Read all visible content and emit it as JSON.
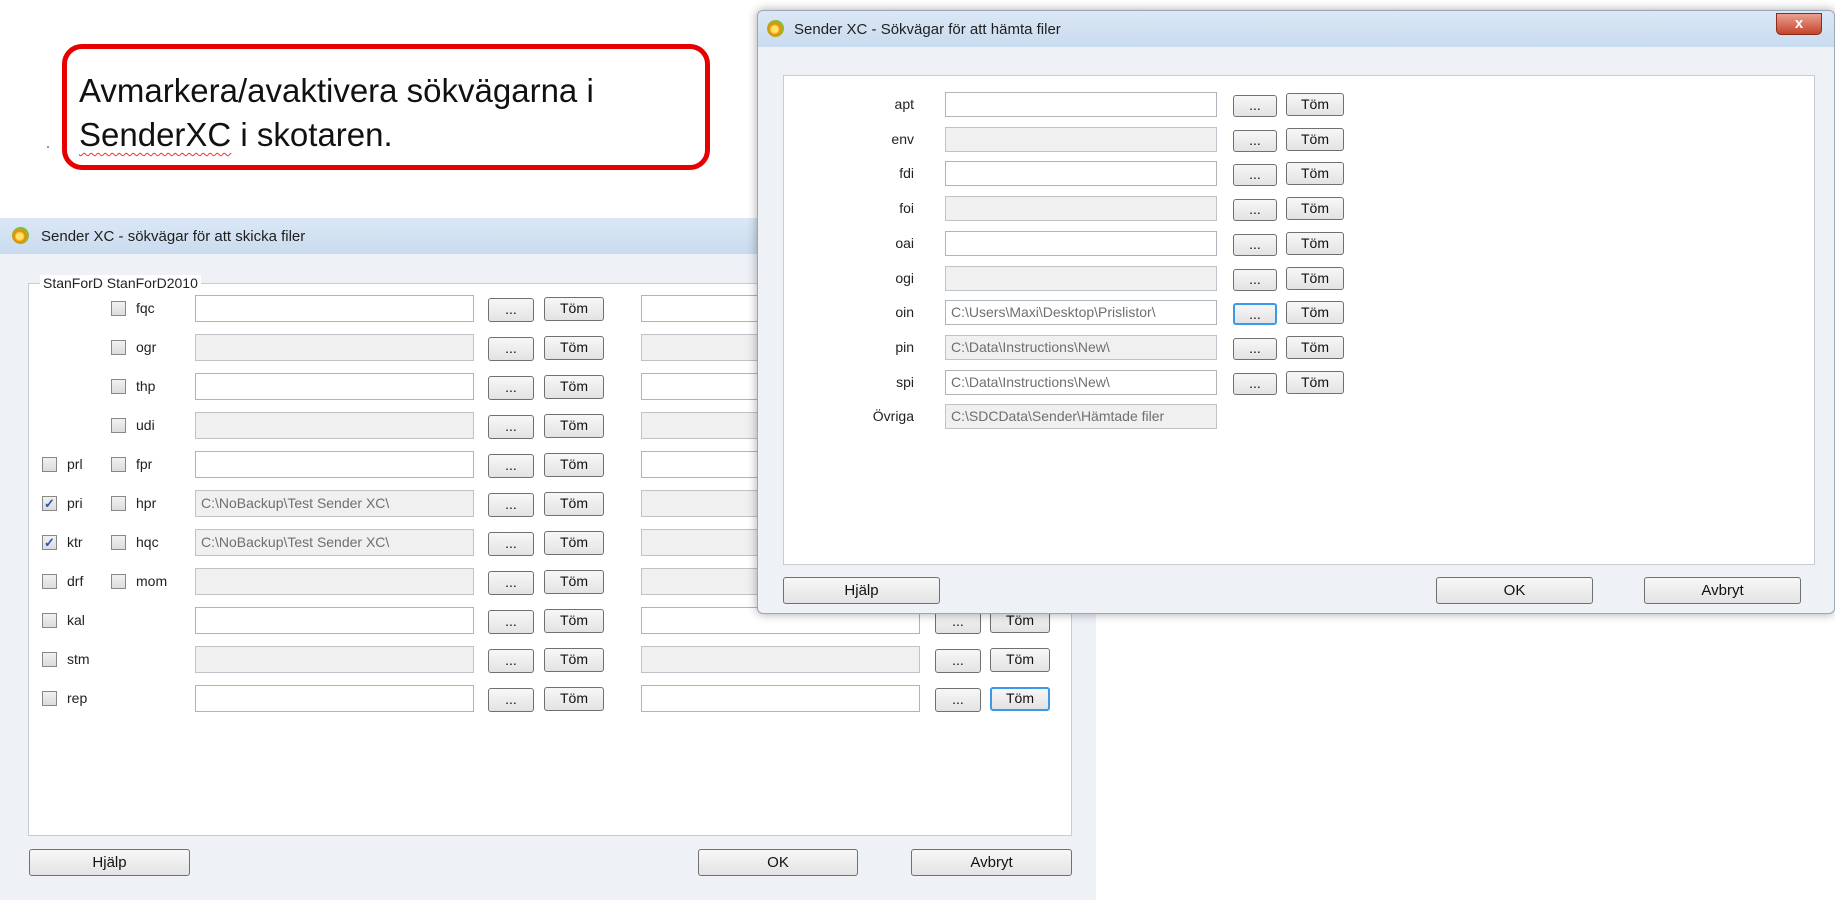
{
  "callout": {
    "line1": "Avmarkera/avaktivera sökvägarna i",
    "line2_word": "SenderXC",
    "line2_rest": " i skotaren."
  },
  "send_window": {
    "title": "Sender XC - sökvägar för att skicka filer",
    "group_label": "StanForD StanForD2010",
    "browse_label": "...",
    "clear_label": "Töm",
    "left_labels": [
      "prl",
      "pri",
      "ktr",
      "drf",
      "kal",
      "stm",
      "rep"
    ],
    "left_checked": [
      false,
      true,
      true,
      false,
      false,
      false,
      false
    ],
    "right_labels": [
      "fqc",
      "ogr",
      "thp",
      "udi",
      "fpr",
      "hpr",
      "hqc",
      "mom"
    ],
    "paths": [
      "",
      "",
      "",
      "",
      "",
      "C:\\NoBackup\\Test Sender XC\\",
      "C:\\NoBackup\\Test Sender XC\\",
      "",
      "",
      "",
      ""
    ],
    "help_label": "Hjälp",
    "ok_label": "OK",
    "cancel_label": "Avbryt"
  },
  "fetch_window": {
    "title": "Sender XC - Sökvägar för att hämta filer",
    "close_label": "x",
    "browse_label": "...",
    "clear_label": "Töm",
    "labels": [
      "apt",
      "env",
      "fdi",
      "foi",
      "oai",
      "ogi",
      "oin",
      "pin",
      "spi",
      "Övriga"
    ],
    "paths": [
      "",
      "",
      "",
      "",
      "",
      "",
      "C:\\Users\\Maxi\\Desktop\\Prislistor\\",
      "C:\\Data\\Instructions\\New\\",
      "C:\\Data\\Instructions\\New\\",
      "C:\\SDCData\\Sender\\Hämtade filer"
    ],
    "help_label": "Hjälp",
    "ok_label": "OK",
    "cancel_label": "Avbryt"
  }
}
